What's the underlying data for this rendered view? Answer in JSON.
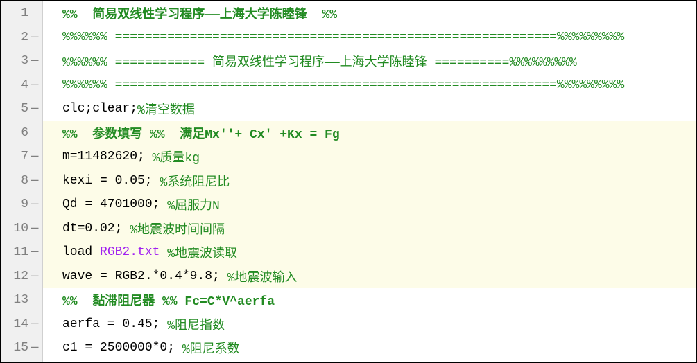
{
  "lines": [
    {
      "num": "1",
      "mark": "",
      "section": false,
      "spans": [
        {
          "cls": "c-section",
          "t": "%%  简易双线性学习程序——上海大学陈睦锋  %%"
        }
      ]
    },
    {
      "num": "2",
      "mark": "—",
      "section": false,
      "spans": [
        {
          "cls": "c-comment",
          "t": "%%%%%% ===========================================================%%%%%%%%%"
        }
      ]
    },
    {
      "num": "3",
      "mark": "—",
      "section": false,
      "spans": [
        {
          "cls": "c-comment",
          "t": "%%%%%% ============ 简易双线性学习程序——上海大学陈睦锋 ==========%%%%%%%%%"
        }
      ]
    },
    {
      "num": "4",
      "mark": "—",
      "section": false,
      "spans": [
        {
          "cls": "c-comment",
          "t": "%%%%%% ===========================================================%%%%%%%%%"
        }
      ]
    },
    {
      "num": "5",
      "mark": "—",
      "section": false,
      "spans": [
        {
          "cls": "c-code",
          "t": "clc;clear;"
        },
        {
          "cls": "c-comment",
          "t": "%清空数据"
        }
      ]
    },
    {
      "num": "6",
      "mark": "",
      "section": true,
      "spans": [
        {
          "cls": "c-section",
          "t": "%%  参数填写 %%  满足Mx''+ Cx' +Kx = Fg"
        }
      ]
    },
    {
      "num": "7",
      "mark": "—",
      "section": true,
      "spans": [
        {
          "cls": "c-code",
          "t": "m=11482620; "
        },
        {
          "cls": "c-comment",
          "t": "%质量kg"
        }
      ]
    },
    {
      "num": "8",
      "mark": "—",
      "section": true,
      "spans": [
        {
          "cls": "c-code",
          "t": "kexi = 0.05; "
        },
        {
          "cls": "c-comment",
          "t": "%系统阻尼比"
        }
      ]
    },
    {
      "num": "9",
      "mark": "—",
      "section": true,
      "spans": [
        {
          "cls": "c-code",
          "t": "Qd = 4701000; "
        },
        {
          "cls": "c-comment",
          "t": "%屈服力N"
        }
      ]
    },
    {
      "num": "10",
      "mark": "—",
      "section": true,
      "spans": [
        {
          "cls": "c-code",
          "t": "dt=0.02; "
        },
        {
          "cls": "c-comment",
          "t": "%地震波时间间隔"
        }
      ]
    },
    {
      "num": "11",
      "mark": "—",
      "section": true,
      "spans": [
        {
          "cls": "c-code",
          "t": "load "
        },
        {
          "cls": "c-string",
          "t": "RGB2.txt "
        },
        {
          "cls": "c-comment",
          "t": "%地震波读取"
        }
      ]
    },
    {
      "num": "12",
      "mark": "—",
      "section": true,
      "spans": [
        {
          "cls": "c-code",
          "t": "wave = RGB2.*0.4*9.8; "
        },
        {
          "cls": "c-comment",
          "t": "%地震波输入"
        }
      ]
    },
    {
      "num": "13",
      "mark": "",
      "section": false,
      "spans": [
        {
          "cls": "c-section",
          "t": "%%  黏滞阻尼器 %% Fc=C*V^aerfa"
        }
      ]
    },
    {
      "num": "14",
      "mark": "—",
      "section": false,
      "spans": [
        {
          "cls": "c-code",
          "t": "aerfa = 0.45; "
        },
        {
          "cls": "c-comment",
          "t": "%阻尼指数"
        }
      ]
    },
    {
      "num": "15",
      "mark": "—",
      "section": false,
      "spans": [
        {
          "cls": "c-code",
          "t": "c1 = 2500000*0; "
        },
        {
          "cls": "c-comment",
          "t": "%阻尼系数"
        }
      ]
    }
  ]
}
